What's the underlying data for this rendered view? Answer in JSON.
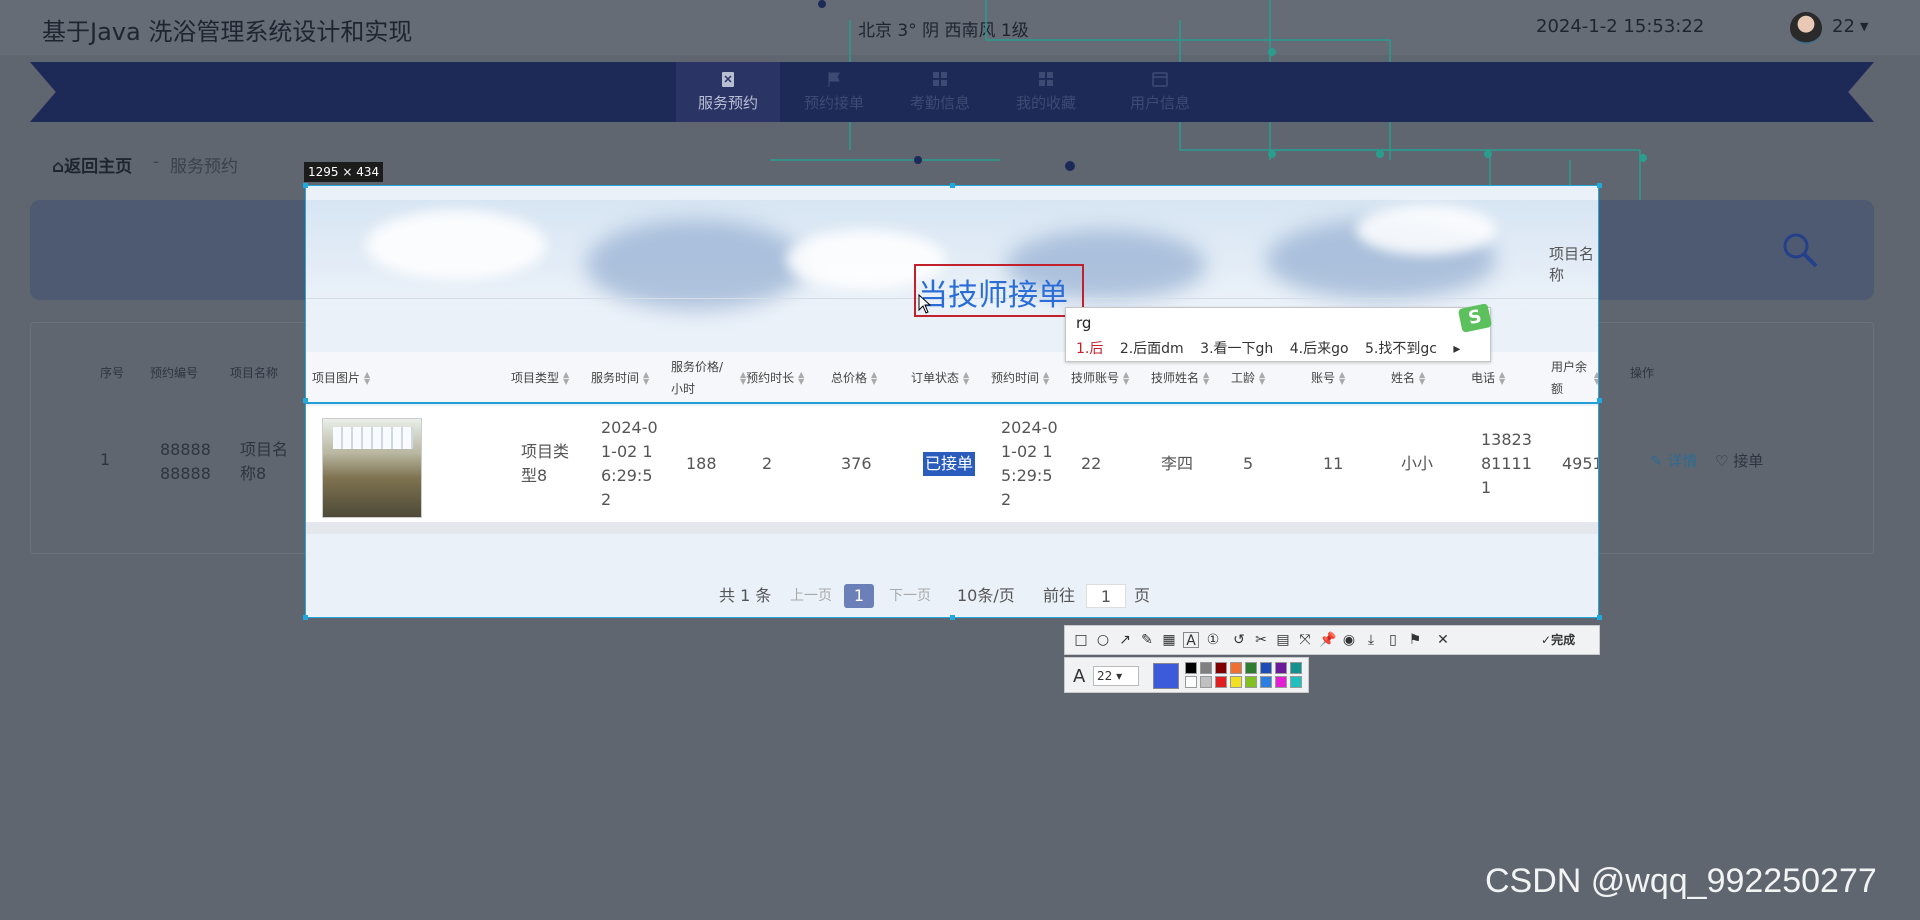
{
  "header": {
    "title": "基于Java 洗浴管理系统设计和实现",
    "weather": "北京  3°  阴  西南风  1级",
    "datetime": "2024-1-2 15:53:22",
    "user": "22"
  },
  "nav": [
    {
      "label": "服务预约",
      "icon": "clipboard-icon",
      "active": true
    },
    {
      "label": "预约接单",
      "icon": "flag-icon",
      "active": false
    },
    {
      "label": "考勤信息",
      "icon": "grid-icon",
      "active": false
    },
    {
      "label": "我的收藏",
      "icon": "grid-icon",
      "active": false
    },
    {
      "label": "用户信息",
      "icon": "calendar-icon",
      "active": false
    }
  ],
  "breadcrumb": {
    "home": "返回主页",
    "separator": "-",
    "current": "服务预约"
  },
  "capture": {
    "size_label": "1295 × 434",
    "annotation": "当技师接单"
  },
  "search": {
    "label": "项目名称",
    "placeholder": "项目名称"
  },
  "table": {
    "columns": [
      "序号",
      "预约编号",
      "项目名称",
      "项目图片",
      "项目类型",
      "服务时间",
      "服务价格/小时",
      "预约时长",
      "总价格",
      "订单状态",
      "预约时间",
      "技师账号",
      "技师姓名",
      "工龄",
      "账号",
      "姓名",
      "电话",
      "用户余额",
      "操作"
    ],
    "rows": [
      {
        "index": "1",
        "order_no": "8888888888",
        "project_name": "项目名称8",
        "project_type": "项目类型8",
        "service_time": "2024-01-02 16:29:52",
        "price_per_hour": "188",
        "duration": "2",
        "total": "376",
        "status": "已接单",
        "book_time": "2024-01-02 15:29:52",
        "tech_account": "22",
        "tech_name": "李四",
        "seniority": "5",
        "account": "11",
        "name": "小小",
        "phone": "13823811111",
        "balance": "4951",
        "detail": "详情",
        "accept": "接单"
      }
    ]
  },
  "pager": {
    "total": "共 1 条",
    "prev": "上一页",
    "page": "1",
    "next": "下一页",
    "size": "10条/页",
    "goto": "前往",
    "goto_value": "1",
    "page_unit": "页"
  },
  "ime": {
    "input": "rg",
    "candidates": [
      "1.后",
      "2.后面dm",
      "3.看一下gh",
      "4.后来go",
      "5.找不到gc"
    ],
    "logo": "S"
  },
  "toolbar": {
    "done": "完成",
    "font_size": "22",
    "current_color": "#3b5bdb",
    "palette_top": [
      "#000000",
      "#808080",
      "#800000",
      "#f07030",
      "#2e7d32",
      "#1e4db7",
      "#6a1b9a",
      "#13918f"
    ],
    "palette_bottom": [
      "#ffffff",
      "#c0c0c0",
      "#e02020",
      "#f0e020",
      "#80c020",
      "#2a7de1",
      "#e020d0",
      "#20c0c0"
    ]
  },
  "watermark": "CSDN @wqq_992250277"
}
